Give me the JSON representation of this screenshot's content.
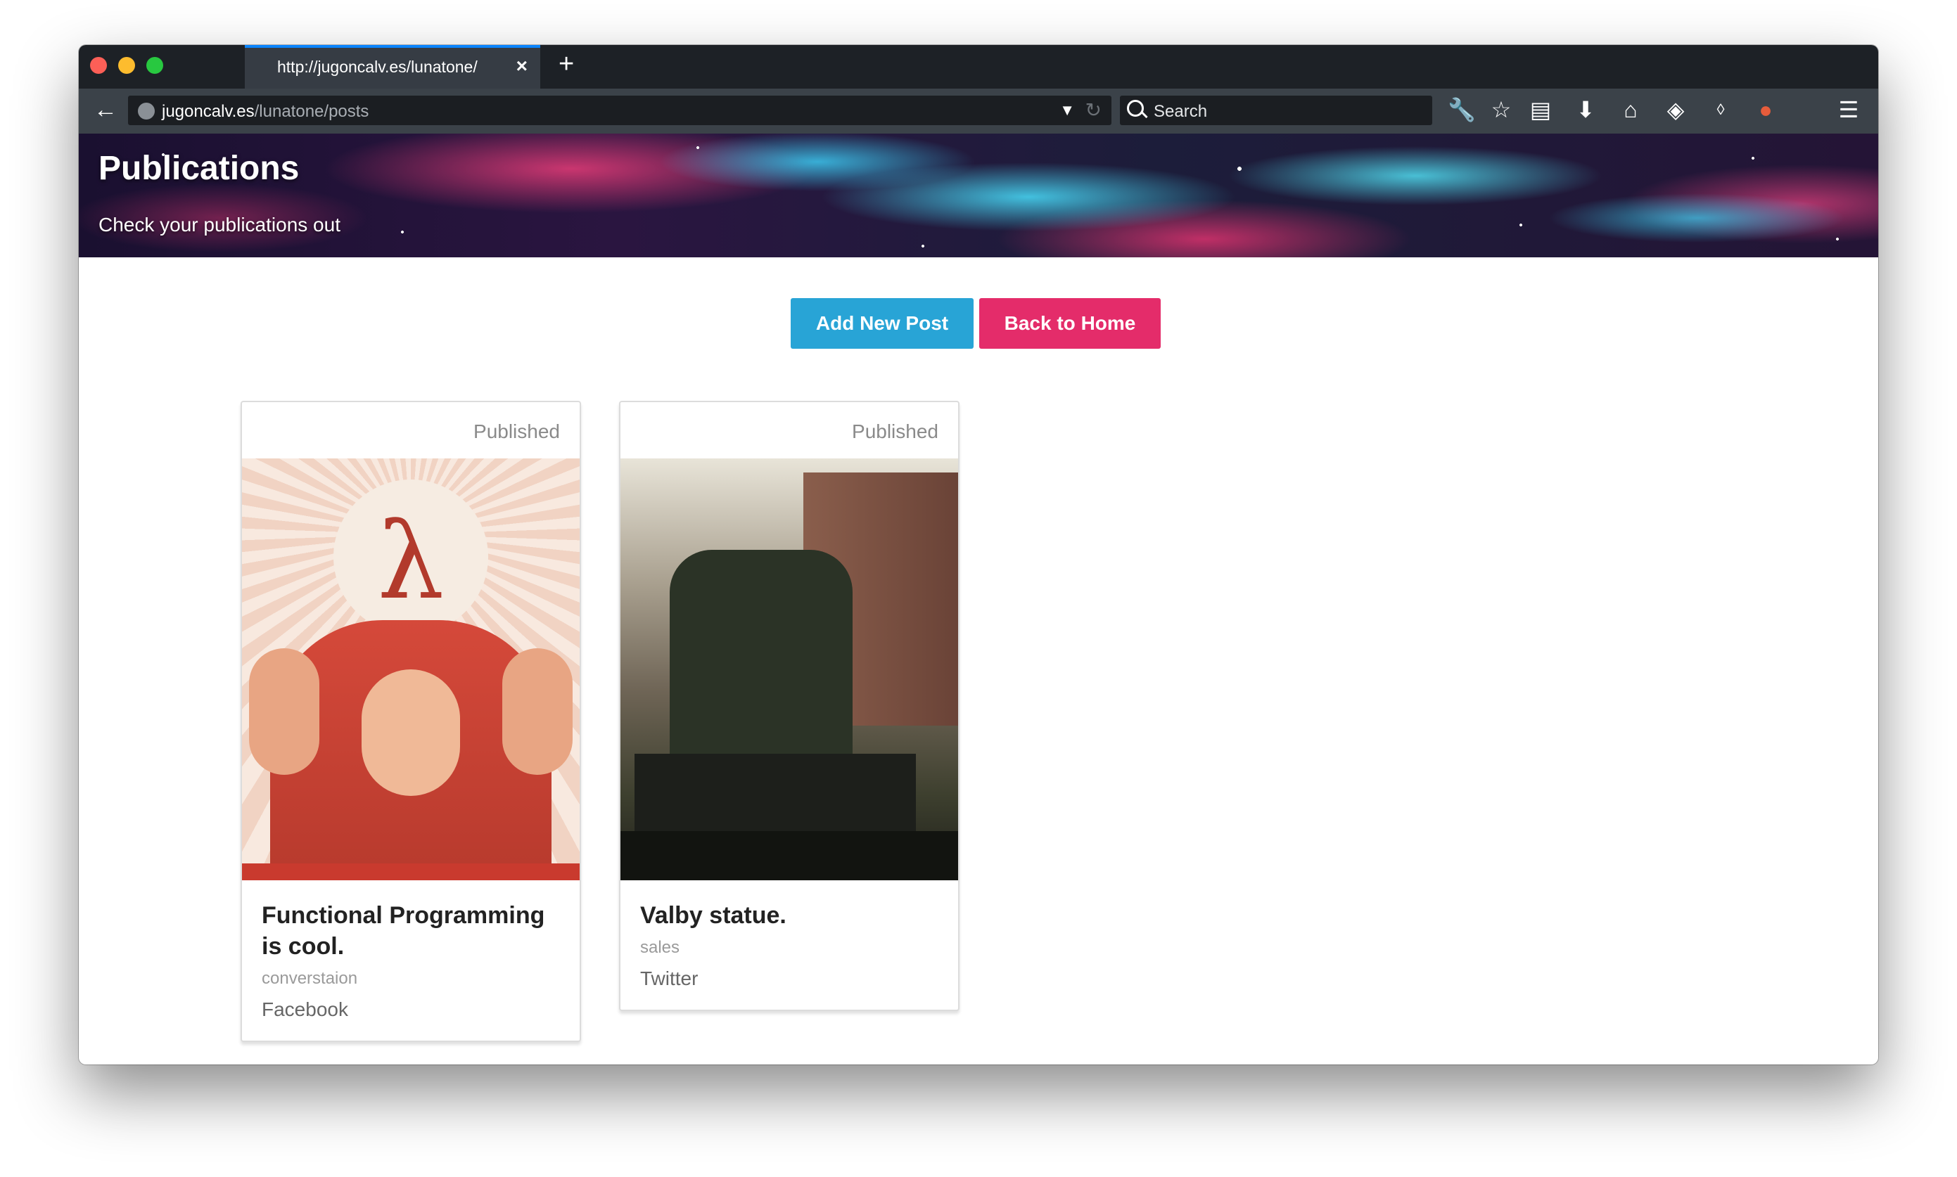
{
  "browser": {
    "tab_title": "http://jugoncalv.es/lunatone/",
    "tab_close": "×",
    "new_tab": "+",
    "url_host": "jugoncalv.es",
    "url_path": "/lunatone/posts",
    "search_placeholder": "Search"
  },
  "header": {
    "title": "Publications",
    "subtitle": "Check your publications out"
  },
  "actions": {
    "add_label": "Add New Post",
    "home_label": "Back to Home"
  },
  "posts": [
    {
      "status": "Published",
      "image_text": "λ",
      "title": "Functional Programming is cool.",
      "category": "converstaion",
      "network": "Facebook"
    },
    {
      "status": "Published",
      "title": "Valby statue.",
      "category": "sales",
      "network": "Twitter"
    }
  ],
  "colors": {
    "add_button": "#28a4d6",
    "home_button": "#e42c6a",
    "tab_accent": "#0a84ff"
  },
  "icons": [
    "back-icon",
    "globe-icon",
    "dropdown-icon",
    "reload-icon",
    "search-icon",
    "wrench-icon",
    "bookmark-star-icon",
    "reading-list-icon",
    "download-icon",
    "home-icon",
    "privacy-icon",
    "extension-icon",
    "addon-icon",
    "menu-icon"
  ]
}
